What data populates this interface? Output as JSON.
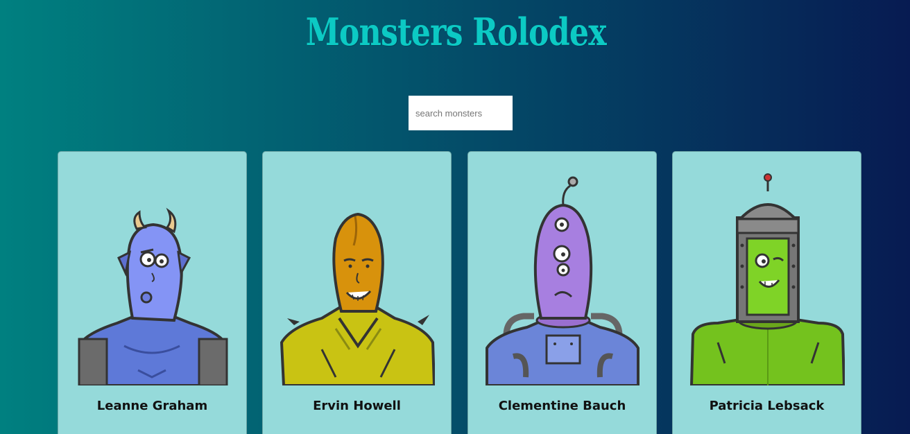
{
  "app": {
    "title": "Monsters Rolodex"
  },
  "search": {
    "placeholder": "search monsters",
    "value": ""
  },
  "monsters": [
    {
      "name": "Leanne Graham",
      "color": "#7b8cf0"
    },
    {
      "name": "Ervin Howell",
      "color": "#d4a017"
    },
    {
      "name": "Clementine Bauch",
      "color": "#a77fe0"
    },
    {
      "name": "Patricia Lebsack",
      "color": "#6fcf2a"
    }
  ],
  "theme": {
    "gradient_start": "#008080",
    "gradient_end": "#071b52",
    "title_color": "#0ccac4",
    "card_bg": "#95dada"
  }
}
